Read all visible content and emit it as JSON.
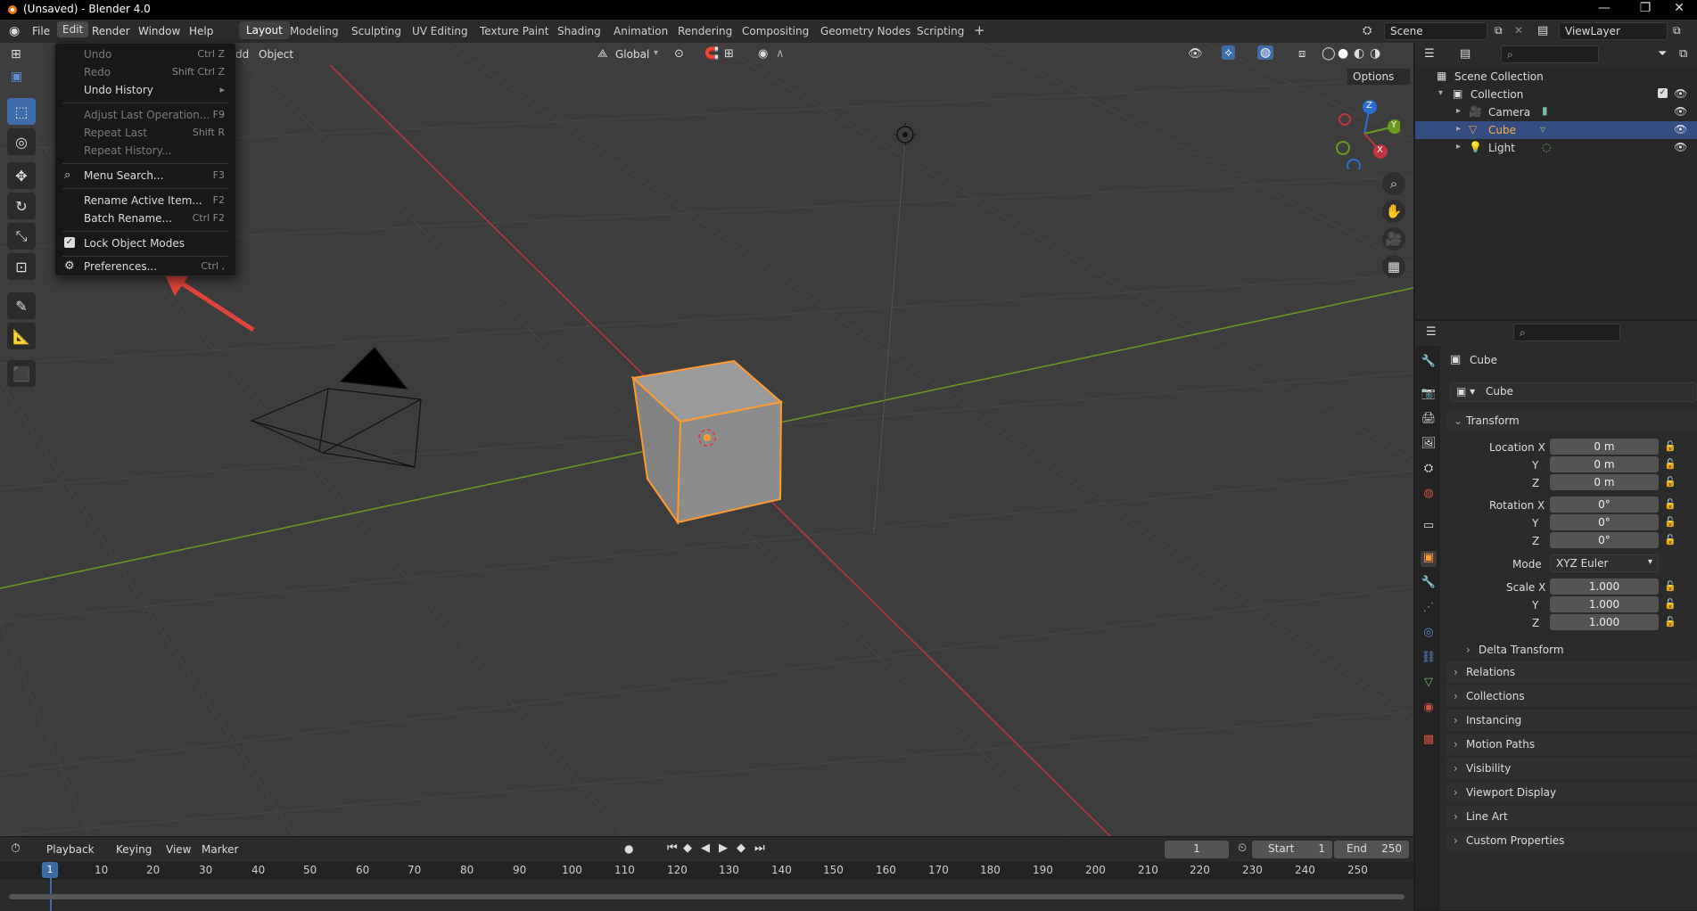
{
  "window": {
    "title": "(Unsaved) - Blender 4.0",
    "controls": [
      "—",
      "❐",
      "✕"
    ]
  },
  "menubar": {
    "items": [
      "File",
      "Edit",
      "Render",
      "Window",
      "Help"
    ],
    "active": "Edit"
  },
  "workspaces": {
    "tabs": [
      "Layout",
      "Modeling",
      "Sculpting",
      "UV Editing",
      "Texture Paint",
      "Shading",
      "Animation",
      "Rendering",
      "Compositing",
      "Geometry Nodes",
      "Scripting"
    ],
    "active": "Layout",
    "add": "+"
  },
  "scene": {
    "label": "Scene",
    "viewlayer": "ViewLayer"
  },
  "viewport_header": {
    "add_partial": "dd",
    "object_menu": "Object",
    "transform_orientation": "Global",
    "options": "Options"
  },
  "edit_menu": {
    "items": [
      {
        "label": "Undo",
        "shortcut": "Ctrl Z",
        "disabled": true
      },
      {
        "label": "Redo",
        "shortcut": "Shift Ctrl Z",
        "disabled": true
      },
      {
        "label": "Undo History",
        "shortcut": "▸",
        "disabled": false
      },
      {
        "label": "Adjust Last Operation...",
        "shortcut": "F9",
        "disabled": true
      },
      {
        "label": "Repeat Last",
        "shortcut": "Shift R",
        "disabled": true
      },
      {
        "label": "Repeat History...",
        "shortcut": "",
        "disabled": true
      },
      {
        "label": "Menu Search...",
        "shortcut": "F3",
        "disabled": false
      },
      {
        "label": "Rename Active Item...",
        "shortcut": "F2",
        "disabled": false
      },
      {
        "label": "Batch Rename...",
        "shortcut": "Ctrl F2",
        "disabled": false
      },
      {
        "label": "Lock Object Modes",
        "shortcut": "",
        "disabled": false,
        "checked": true
      },
      {
        "label": "Preferences...",
        "shortcut": "Ctrl ,",
        "disabled": false
      }
    ]
  },
  "gizmo": {
    "x": "X",
    "y": "Y",
    "z": "Z"
  },
  "timeline": {
    "menus": [
      "Playback",
      "Keying",
      "View",
      "Marker"
    ],
    "current_frame": "1",
    "start_label": "Start",
    "start": "1",
    "end_label": "End",
    "end": "250",
    "ticks": [
      "1",
      "10",
      "20",
      "30",
      "40",
      "50",
      "60",
      "70",
      "80",
      "90",
      "100",
      "110",
      "120",
      "130",
      "140",
      "150",
      "160",
      "170",
      "180",
      "190",
      "200",
      "210",
      "220",
      "230",
      "240",
      "250"
    ]
  },
  "outliner": {
    "root": "Scene Collection",
    "collection": "Collection",
    "items": [
      {
        "name": "Camera",
        "icon": "camera-icon",
        "selected": false
      },
      {
        "name": "Cube",
        "icon": "mesh-icon",
        "selected": true
      },
      {
        "name": "Light",
        "icon": "light-icon",
        "selected": false
      }
    ]
  },
  "properties": {
    "object_name": "Cube",
    "datablock": "Cube",
    "transform_title": "Transform",
    "location": {
      "label": "Location X",
      "x": "0 m",
      "y": "0 m",
      "z": "0 m"
    },
    "rotation": {
      "label": "Rotation X",
      "x": "0°",
      "y": "0°",
      "z": "0°"
    },
    "mode_label": "Mode",
    "mode": "XYZ Euler",
    "scale": {
      "label": "Scale X",
      "x": "1.000",
      "y": "1.000",
      "z": "1.000"
    },
    "axis_y": "Y",
    "axis_z": "Z",
    "delta": "Delta Transform",
    "panels": [
      "Relations",
      "Collections",
      "Instancing",
      "Motion Paths",
      "Visibility",
      "Viewport Display",
      "Line Art",
      "Custom Properties"
    ]
  },
  "colors": {
    "accent": "#3e6ca8",
    "selection": "#334d80",
    "orange_outline": "#ff9a2f",
    "x_axis": "#c0343f",
    "y_axis": "#6c9a1e",
    "arrow": "#e0443a"
  }
}
